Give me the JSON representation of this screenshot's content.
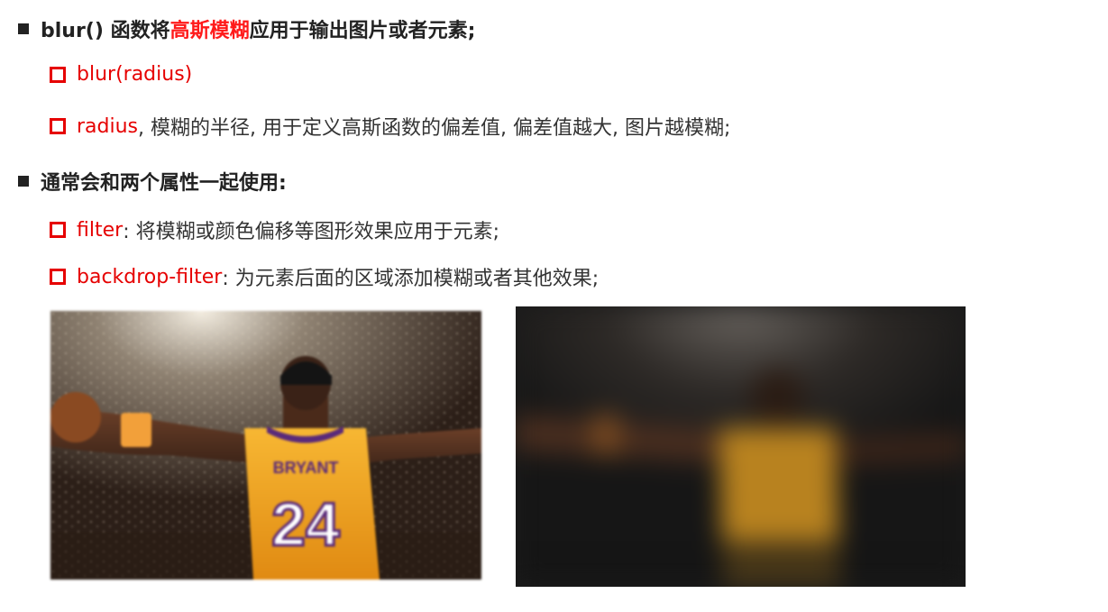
{
  "bullets": {
    "b1": {
      "pre": "blur() 函数将",
      "highlight": "高斯模糊",
      "post": "应用于输出图片或者元素;"
    },
    "b1_1": {
      "term": "blur(radius)"
    },
    "b1_2": {
      "term": "radius",
      "desc": ", 模糊的半径, 用于定义高斯函数的偏差值, 偏差值越大, 图片越模糊;"
    },
    "b2": {
      "text": "通常会和两个属性一起使用:"
    },
    "b2_1": {
      "term": "filter",
      "desc": ": 将模糊或颜色偏移等图形效果应用于元素;"
    },
    "b2_2": {
      "term": "backdrop-filter",
      "desc": ": 为元素后面的区域添加模糊或者其他效果;"
    }
  },
  "jersey": {
    "name": "BRYANT",
    "number": "24"
  },
  "colors": {
    "accent_red": "#e60000",
    "highlight_red": "#ff1a1a",
    "jersey_yellow": "#f5a623"
  }
}
